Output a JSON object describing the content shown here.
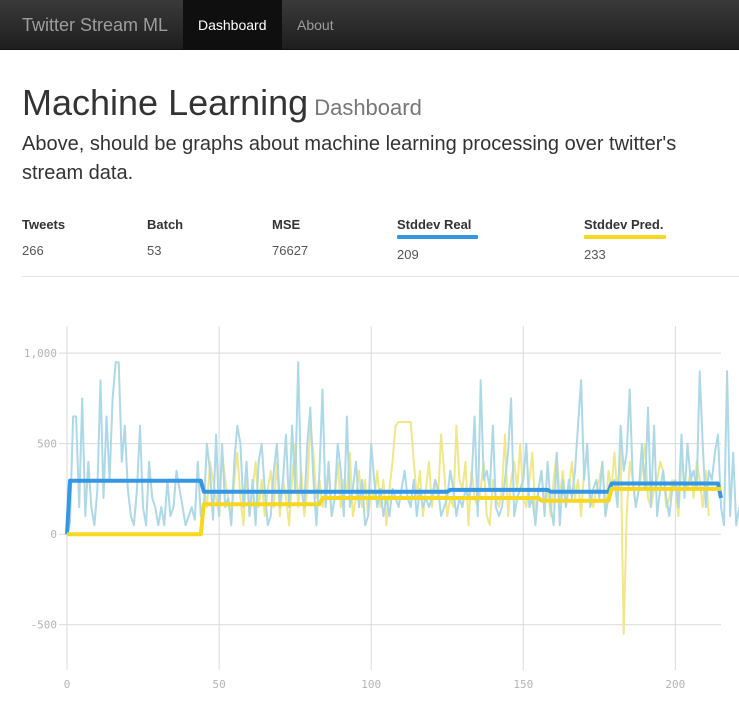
{
  "navbar": {
    "brand": "Twitter Stream ML",
    "items": [
      {
        "label": "Dashboard",
        "active": true
      },
      {
        "label": "About",
        "active": false
      }
    ]
  },
  "header": {
    "title": "Machine Learning",
    "subtitle": "Dashboard",
    "lead": "Above, should be graphs about machine learning processing over twitter's stream data."
  },
  "stats": [
    {
      "label": "Tweets",
      "value": "266"
    },
    {
      "label": "Batch",
      "value": "53"
    },
    {
      "label": "MSE",
      "value": "76627"
    },
    {
      "label": "Stddev Real",
      "value": "209",
      "color": "#3596e3"
    },
    {
      "label": "Stddev Pred.",
      "value": "233",
      "color": "#f7d71f"
    }
  ],
  "chart_data": {
    "type": "line",
    "xlim": [
      0,
      215
    ],
    "ylim": [
      -750,
      1150
    ],
    "x_ticks": [
      0,
      50,
      100,
      150,
      200
    ],
    "y_ticks": [
      -500,
      0,
      500,
      1000
    ],
    "y_tick_labels": [
      "-500",
      "0",
      "500",
      "1,000"
    ],
    "grid": true,
    "colors": {
      "real": "#add8e6",
      "pred": "#f0e68c",
      "stddev_real": "#3596e3",
      "stddev_pred": "#f7d71f"
    },
    "series_real_noisy": {
      "values": [
        0,
        60,
        650,
        650,
        150,
        750,
        100,
        400,
        150,
        50,
        250,
        850,
        200,
        650,
        300,
        750,
        950,
        950,
        400,
        600,
        250,
        100,
        50,
        250,
        600,
        150,
        50,
        400,
        200,
        150,
        50,
        150,
        50,
        300,
        100,
        150,
        350,
        250,
        150,
        50,
        100,
        150,
        80,
        400,
        100,
        150,
        500,
        350,
        80,
        550,
        100,
        500,
        150,
        200,
        50,
        400,
        600,
        500,
        150,
        400,
        100,
        300,
        50,
        400,
        500,
        250,
        50,
        100,
        350,
        500,
        150,
        300,
        550,
        150,
        600,
        250,
        950,
        250,
        150,
        500,
        700,
        300,
        50,
        350,
        800,
        150,
        400,
        100,
        200,
        500,
        350,
        100,
        650,
        150,
        250,
        400,
        150,
        300,
        50,
        100,
        500,
        300,
        150,
        250,
        100,
        200,
        100,
        250,
        200,
        150,
        250,
        350,
        200,
        150,
        300,
        100,
        250,
        150,
        200,
        150,
        200,
        300,
        250,
        100,
        150,
        200,
        350,
        250,
        100,
        200,
        150,
        250,
        200,
        300,
        650,
        100,
        850,
        300,
        350,
        250,
        600,
        150,
        100,
        150,
        300,
        450,
        750,
        100,
        200,
        250,
        300,
        500,
        150,
        200,
        50,
        250,
        350,
        100,
        400,
        150,
        50,
        450,
        50,
        300,
        150,
        300,
        200,
        350,
        600,
        850,
        300,
        500,
        150,
        250,
        300,
        200,
        400,
        100,
        200,
        250,
        300,
        150,
        600,
        350,
        450,
        800,
        300,
        150,
        250,
        500,
        250,
        700,
        150,
        600,
        100,
        250,
        350,
        200,
        100,
        250,
        300,
        150,
        550,
        200,
        500,
        300,
        350,
        250,
        900,
        500,
        150,
        350,
        300,
        450,
        550,
        150,
        50,
        900,
        100,
        450,
        50,
        150
      ]
    },
    "series_pred_noisy": {
      "values": [
        null,
        null,
        null,
        null,
        null,
        null,
        null,
        null,
        null,
        null,
        null,
        null,
        null,
        null,
        null,
        null,
        null,
        null,
        null,
        null,
        null,
        null,
        null,
        null,
        null,
        null,
        null,
        null,
        null,
        null,
        null,
        null,
        null,
        null,
        null,
        null,
        null,
        null,
        null,
        null,
        null,
        null,
        null,
        null,
        null,
        250,
        150,
        400,
        300,
        200,
        100,
        450,
        300,
        200,
        100,
        300,
        450,
        200,
        50,
        350,
        100,
        250,
        400,
        150,
        300,
        100,
        250,
        350,
        150,
        400,
        100,
        300,
        200,
        50,
        300,
        500,
        150,
        350,
        100,
        250,
        600,
        450,
        200,
        300,
        150,
        250,
        350,
        100,
        200,
        400,
        150,
        300,
        250,
        450,
        100,
        200,
        350,
        150,
        300,
        100,
        250,
        200,
        350,
        150,
        300,
        50,
        250,
        400,
        600,
        620,
        620,
        620,
        620,
        620,
        400,
        200,
        350,
        100,
        250,
        400,
        150,
        300,
        200,
        550,
        350,
        100,
        200,
        150,
        600,
        300,
        250,
        400,
        50,
        350,
        200,
        150,
        250,
        400,
        100,
        50,
        300,
        200,
        150,
        250,
        550,
        100,
        300,
        400,
        250,
        500,
        200,
        150,
        300,
        450,
        100,
        250,
        350,
        150,
        250,
        100,
        300,
        450,
        200,
        350,
        150,
        250,
        400,
        200,
        300,
        100,
        350,
        450,
        200,
        150,
        250,
        300,
        400,
        100,
        350,
        250,
        450,
        200,
        500,
        -550,
        100,
        400,
        300,
        150,
        250,
        350,
        500,
        200,
        150,
        250,
        300,
        400,
        350,
        150,
        200,
        300,
        250,
        100,
        400,
        300,
        250,
        350,
        200,
        400,
        300,
        150,
        350,
        100
      ]
    },
    "series_stddev_real": {
      "x": [
        0,
        1,
        44,
        45,
        125,
        126,
        158,
        159,
        178,
        179,
        214,
        215
      ],
      "values": [
        0,
        295,
        295,
        235,
        235,
        245,
        245,
        235,
        235,
        280,
        280,
        200
      ]
    },
    "series_stddev_pred": {
      "x": [
        0,
        44,
        45,
        83,
        84,
        155,
        156,
        178,
        179,
        215
      ],
      "values": [
        0,
        0,
        165,
        165,
        200,
        200,
        185,
        185,
        250,
        250
      ]
    }
  }
}
